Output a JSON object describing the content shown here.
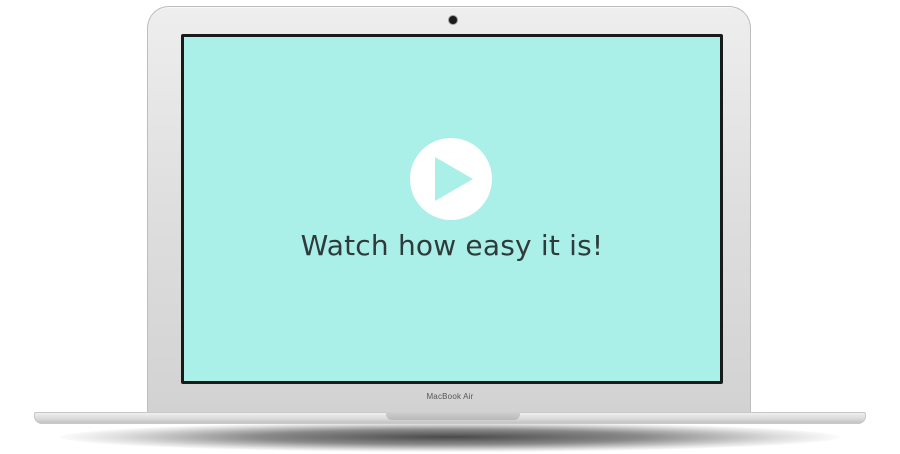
{
  "screen": {
    "headline": "Watch how easy it is!",
    "background_color": "#abefe9",
    "play_button": {
      "icon": "play-icon",
      "color": "#ffffff"
    }
  },
  "laptop": {
    "model_label": "MacBook Air"
  }
}
